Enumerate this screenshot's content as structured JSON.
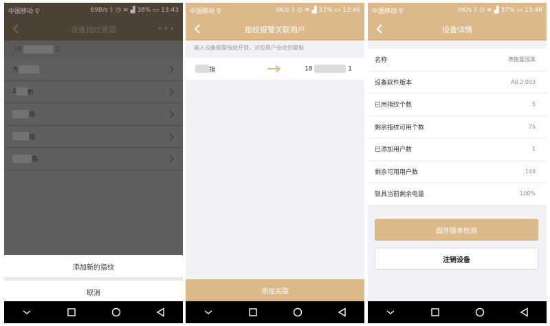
{
  "status_bar_1": {
    "carrier": "中国移动",
    "speed": "69B/s",
    "battery": "38%",
    "time": "13:43"
  },
  "status_bar_2": {
    "carrier": "中国移动",
    "speed": "0K/s",
    "battery": "37%",
    "time": "13:46"
  },
  "status_bar_3": {
    "carrier": "中国移动",
    "speed": "0K/s",
    "battery": "37%",
    "time": "13:46"
  },
  "screen1": {
    "title": "设备指纹管理",
    "account_number_prefix": "18",
    "account_number_suffix": "1",
    "fingerprints": [
      {
        "prefix": "大",
        "suffix": ""
      },
      {
        "prefix": "1",
        "suffix": "右"
      },
      {
        "prefix": "",
        "suffix": "指"
      },
      {
        "prefix": "",
        "suffix": "指"
      },
      {
        "prefix": "",
        "suffix": "指"
      }
    ],
    "add_label": "添加新的指纹",
    "cancel_label": "取消"
  },
  "screen2": {
    "title": "指纹报警关联用户",
    "hint": "输入设备报警指纹开锁，对应用户会收到警报",
    "fingerprint_suffix": "指",
    "phone_prefix": "18",
    "phone_suffix": "1",
    "action_label": "添加关联"
  },
  "screen3": {
    "title": "设备详情",
    "rows": [
      {
        "label": "名称",
        "value": "德施曼国美"
      },
      {
        "label": "设备软件版本",
        "value": "A0.2.003"
      },
      {
        "label": "已用指纹个数",
        "value": "5"
      },
      {
        "label": "剩余指纹可用个数",
        "value": "75"
      },
      {
        "label": "已添加用户数",
        "value": "1"
      },
      {
        "label": "剩余可用用户数",
        "value": "149"
      },
      {
        "label": "锁具当前剩余电量",
        "value": "100%"
      }
    ],
    "firmware_check_label": "固件版本检测",
    "unregister_label": "注销设备"
  },
  "colors": {
    "accent_gold": "#dcb98a",
    "dimmed_overlay": "#5f5f5f",
    "background": "#f2f1f6"
  },
  "icons": [
    "key-icon",
    "bluetooth-icon",
    "alarm-icon",
    "wifi-icon",
    "signal-icon",
    "battery-icon",
    "back-icon",
    "more-icon",
    "chevron-right-icon",
    "arrow-right-icon",
    "nav-back-icon",
    "nav-home-icon",
    "nav-recents-icon",
    "nav-menu-icon"
  ]
}
